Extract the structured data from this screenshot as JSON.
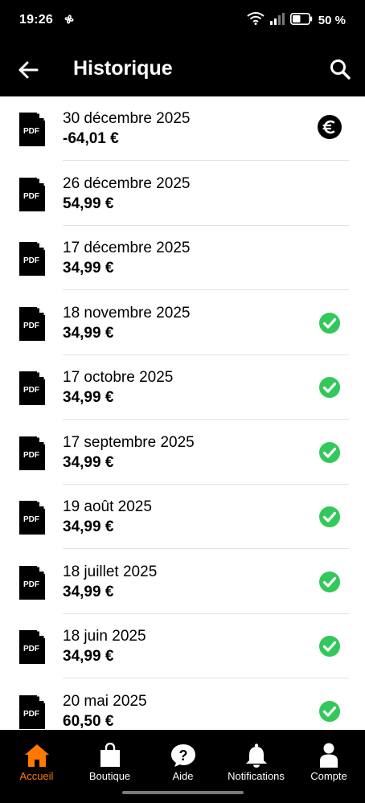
{
  "status_bar": {
    "time": "19:26",
    "battery_percent": "50 %",
    "battery_level": 0.5
  },
  "header": {
    "title": "Historique",
    "back_icon": "arrow-left-icon",
    "search_icon": "search-icon"
  },
  "invoices": [
    {
      "date": "30 décembre 2025",
      "amount": "-64,01 €",
      "status": "euro"
    },
    {
      "date": "26 décembre 2025",
      "amount": "54,99 €",
      "status": "none"
    },
    {
      "date": "17 décembre 2025",
      "amount": "34,99 €",
      "status": "none"
    },
    {
      "date": "18 novembre 2025",
      "amount": "34,99 €",
      "status": "paid"
    },
    {
      "date": "17 octobre 2025",
      "amount": "34,99 €",
      "status": "paid"
    },
    {
      "date": "17 septembre 2025",
      "amount": "34,99 €",
      "status": "paid"
    },
    {
      "date": "19 août 2025",
      "amount": "34,99 €",
      "status": "paid"
    },
    {
      "date": "18 juillet 2025",
      "amount": "34,99 €",
      "status": "paid"
    },
    {
      "date": "18 juin 2025",
      "amount": "34,99 €",
      "status": "paid"
    },
    {
      "date": "20 mai 2025",
      "amount": "60,50 €",
      "status": "paid"
    }
  ],
  "pdf_label": "PDF",
  "bottom_nav": [
    {
      "label": "Accueil",
      "icon": "home-icon",
      "active": true
    },
    {
      "label": "Boutique",
      "icon": "shopping-bag-icon",
      "active": false
    },
    {
      "label": "Aide",
      "icon": "help-icon",
      "active": false
    },
    {
      "label": "Notifications",
      "icon": "bell-icon",
      "active": false
    },
    {
      "label": "Compte",
      "icon": "user-icon",
      "active": false
    }
  ],
  "colors": {
    "accent": "#ff7900",
    "paid_green": "#32c85a",
    "background": "#000000",
    "list_background": "#ffffff"
  }
}
